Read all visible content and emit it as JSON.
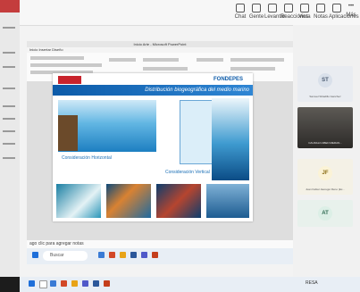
{
  "ppt": {
    "title": "Inicio Arte - Microsoft PowerPoint",
    "menu": "Inicio   Insertar   Diseño",
    "notes_placeholder": "ago clic para agregar notas"
  },
  "slide": {
    "title": "Distribución biogeográfica del medio marino",
    "logo_right": "FONDEPES",
    "caption_horizontal": "Consideración Horizontal",
    "caption_vertical": "Consideración Vertical"
  },
  "teams": {
    "toolbar": [
      "Chat",
      "Gente",
      "Levantar",
      "Reacciones",
      "Vista",
      "Notas",
      "Aplicaciones",
      "Más"
    ]
  },
  "participants": [
    {
      "initials": "ST",
      "name": "Samuel Sibadillo Ganchez",
      "color": "#d9e0ea",
      "text_color": "#4a5a70"
    },
    {
      "initials": "JF",
      "name": "Juan Fabiel Jauregui Reno (Ex...",
      "color": "#fbf3d6",
      "text_color": "#8a6d14"
    },
    {
      "initials": "AT",
      "name": "",
      "color": "#dcefe6",
      "text_color": "#2f6b52"
    }
  ],
  "video_tile": {
    "label": "CAUDALO ABEN MERAN..."
  },
  "taskbar1": {
    "search_label": "Buscar"
  },
  "status": {
    "time_label": "RESA"
  },
  "colors": {
    "accent_blue": "#0b5aa8",
    "peru_red": "#c8232c"
  }
}
